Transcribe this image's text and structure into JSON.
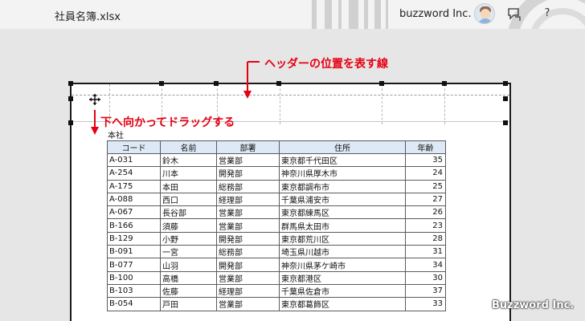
{
  "window": {
    "file_title": "社員名簿.xlsx",
    "user_name": "buzzword Inc.",
    "help_label": "?"
  },
  "sheet": {
    "header_text": "本社",
    "columns": [
      "コード",
      "名前",
      "部署",
      "住所",
      "年齢"
    ],
    "rows": [
      [
        "A-031",
        "鈴木",
        "営業部",
        "東京都千代田区",
        "35"
      ],
      [
        "A-254",
        "川本",
        "開発部",
        "神奈川県厚木市",
        "24"
      ],
      [
        "A-175",
        "本田",
        "総務部",
        "東京都調布市",
        "25"
      ],
      [
        "A-088",
        "西口",
        "経理部",
        "千葉県浦安市",
        "27"
      ],
      [
        "A-067",
        "長谷部",
        "営業部",
        "東京都練馬区",
        "26"
      ],
      [
        "B-166",
        "須藤",
        "営業部",
        "群馬県太田市",
        "23"
      ],
      [
        "B-129",
        "小野",
        "開発部",
        "東京都荒川区",
        "28"
      ],
      [
        "B-091",
        "一宮",
        "総務部",
        "埼玉県川越市",
        "31"
      ],
      [
        "B-077",
        "山羽",
        "開発部",
        "神奈川県茅ケ崎市",
        "34"
      ],
      [
        "B-100",
        "高橋",
        "営業部",
        "東京都港区",
        "30"
      ],
      [
        "B-103",
        "佐藤",
        "経理部",
        "千葉県佐倉市",
        "37"
      ],
      [
        "B-054",
        "戸田",
        "営業部",
        "東京都葛飾区",
        "33"
      ]
    ]
  },
  "annotations": {
    "header_position": "ヘッダーの位置を表す線",
    "drag_down": "下へ向かってドラッグする",
    "color": "#e60012"
  },
  "watermark": "Buzzword Inc.",
  "icons": {
    "move_cursor": "move-cursor-icon",
    "feedback": "feedback-icon",
    "avatar": "user-avatar"
  }
}
